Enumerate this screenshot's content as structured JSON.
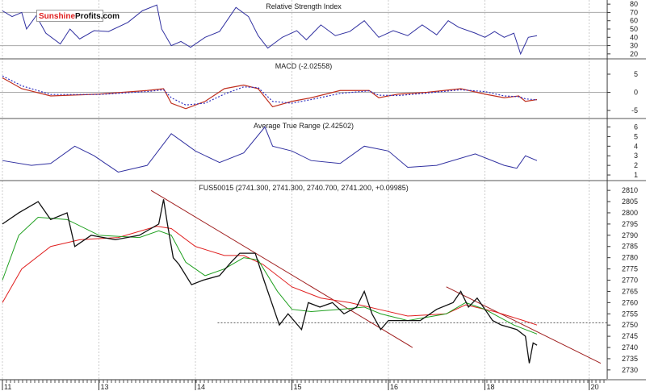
{
  "logo": {
    "part1": "Sunshine",
    "part2": "Profits.com"
  },
  "chart_data": [
    {
      "type": "line",
      "title": "Relative Strength Index",
      "ylim": [
        15,
        85
      ],
      "yticks": [
        20,
        30,
        40,
        50,
        60,
        70,
        80
      ],
      "reference_lines": [
        70,
        30
      ],
      "color": "#3030a0",
      "x": [
        0,
        0.1,
        0.2,
        0.25,
        0.35,
        0.45,
        0.6,
        0.7,
        0.8,
        0.95,
        1.1,
        1.3,
        1.45,
        1.6,
        1.65,
        1.75,
        1.85,
        1.95,
        2.1,
        2.25,
        2.42,
        2.55,
        2.65,
        2.75,
        2.9,
        3.05,
        3.15,
        3.3,
        3.45,
        3.6,
        3.75,
        3.9,
        4.05,
        4.2,
        4.35,
        4.5,
        4.62,
        4.73,
        4.9,
        5.0,
        5.1,
        5.2,
        5.3,
        5.37,
        5.45,
        5.54
      ],
      "values": [
        72,
        65,
        70,
        50,
        66,
        45,
        32,
        50,
        38,
        48,
        47,
        58,
        72,
        79,
        50,
        30,
        35,
        28,
        40,
        47,
        76,
        65,
        42,
        27,
        40,
        48,
        37,
        55,
        42,
        47,
        60,
        40,
        48,
        42,
        55,
        43,
        60,
        52,
        45,
        40,
        47,
        40,
        45,
        20,
        40,
        42
      ]
    },
    {
      "type": "line",
      "title": "MACD (-2.02558)",
      "ylim": [
        -7,
        9
      ],
      "yticks": [
        5,
        0,
        -5
      ],
      "reference_lines": [
        0
      ],
      "x": [
        0,
        0.2,
        0.5,
        1.0,
        1.5,
        1.67,
        1.75,
        1.9,
        2.1,
        2.3,
        2.5,
        2.65,
        2.8,
        3.0,
        3.2,
        3.5,
        3.8,
        3.9,
        4.1,
        4.4,
        4.75,
        5.0,
        5.2,
        5.35,
        5.42,
        5.54
      ],
      "series": [
        {
          "name": "MACD",
          "color": "#c03020",
          "values": [
            4,
            1,
            -1,
            -0.5,
            0.5,
            1,
            -3,
            -4.5,
            -2.5,
            1,
            2,
            1,
            -4,
            -2.5,
            -1.5,
            0.5,
            0.5,
            -1.5,
            -0.5,
            0,
            1,
            -0.5,
            -1.5,
            -1,
            -2.5,
            -2
          ]
        },
        {
          "name": "Signal",
          "color": "#3030c0",
          "dashed": true,
          "values": [
            4.5,
            1.8,
            -0.6,
            -0.6,
            0.2,
            0.7,
            -1.5,
            -3.5,
            -3,
            -0.5,
            1.5,
            1.3,
            -2.5,
            -3,
            -2,
            -0.3,
            0.4,
            -0.8,
            -0.9,
            -0.2,
            0.7,
            0.2,
            -1,
            -1.2,
            -1.8,
            -2.1
          ]
        }
      ]
    },
    {
      "type": "line",
      "title": "Average True Range (2.42502)",
      "ylim": [
        0.5,
        6.8
      ],
      "yticks": [
        1,
        2,
        3,
        4,
        5,
        6
      ],
      "color": "#3030a0",
      "x": [
        0,
        0.3,
        0.5,
        0.75,
        0.95,
        1.2,
        1.5,
        1.75,
        2.0,
        2.25,
        2.5,
        2.72,
        2.8,
        3.0,
        3.2,
        3.5,
        3.75,
        4.0,
        4.2,
        4.5,
        4.9,
        5.2,
        5.33,
        5.42,
        5.54
      ],
      "values": [
        2.5,
        2,
        2.2,
        4,
        3,
        1.3,
        2,
        5.3,
        3.5,
        2.3,
        3.3,
        6,
        4,
        3.5,
        2.5,
        2.2,
        4,
        3.5,
        1.8,
        2,
        3.2,
        2,
        1.7,
        3,
        2.5
      ]
    },
    {
      "type": "line",
      "title": "FUS50015 (2741.300, 2741.300, 2740.700, 2741.200, +0.09985)",
      "ylim": [
        2726,
        2814
      ],
      "yticks": [
        2730,
        2735,
        2740,
        2745,
        2750,
        2755,
        2760,
        2765,
        2770,
        2775,
        2780,
        2785,
        2790,
        2795,
        2800,
        2805,
        2810
      ],
      "xticks": [
        {
          "t": 0,
          "label": "11"
        },
        {
          "t": 1,
          "label": "13"
        },
        {
          "t": 2,
          "label": "14"
        },
        {
          "t": 3,
          "label": "15"
        },
        {
          "t": 4,
          "label": "16"
        },
        {
          "t": 5,
          "label": "18"
        },
        {
          "t": 6.08,
          "label": "20"
        }
      ],
      "price": {
        "color": "#111111",
        "x": [
          0,
          0.17,
          0.37,
          0.5,
          0.67,
          0.75,
          0.92,
          1.17,
          1.42,
          1.62,
          1.67,
          1.71,
          1.77,
          1.83,
          1.96,
          2.08,
          2.25,
          2.37,
          2.46,
          2.62,
          2.71,
          2.79,
          2.87,
          2.96,
          3.1,
          3.17,
          3.29,
          3.42,
          3.54,
          3.67,
          3.75,
          3.83,
          3.92,
          4.0,
          4.17,
          4.33,
          4.5,
          4.67,
          4.75,
          4.83,
          4.92,
          5.0,
          5.08,
          5.17,
          5.33,
          5.42,
          5.46,
          5.5,
          5.54
        ],
        "values": [
          2795,
          2800,
          2805,
          2797,
          2800,
          2785,
          2790,
          2788,
          2790,
          2795,
          2806,
          2795,
          2780,
          2777,
          2768,
          2770,
          2772,
          2778,
          2782,
          2782,
          2770,
          2760,
          2750,
          2755,
          2748,
          2760,
          2758,
          2760,
          2755,
          2758,
          2765,
          2755,
          2748,
          2752,
          2752,
          2752,
          2757,
          2760,
          2765,
          2758,
          2762,
          2757,
          2752,
          2750,
          2748,
          2745,
          2733,
          2742,
          2741
        ]
      },
      "ma_short": {
        "color": "#20a020",
        "x": [
          0,
          0.17,
          0.37,
          0.67,
          1.0,
          1.42,
          1.62,
          1.75,
          1.9,
          2.1,
          2.3,
          2.5,
          2.65,
          2.85,
          3.0,
          3.2,
          3.5,
          3.75,
          3.92,
          4.2,
          4.6,
          4.8,
          5.0,
          5.3,
          5.54
        ],
        "values": [
          2770,
          2790,
          2798,
          2797,
          2790,
          2789,
          2792,
          2790,
          2778,
          2772,
          2775,
          2780,
          2779,
          2765,
          2757,
          2756,
          2757,
          2758,
          2755,
          2752,
          2755,
          2760,
          2757,
          2750,
          2746
        ]
      },
      "ma_long": {
        "color": "#e02020",
        "x": [
          0,
          0.2,
          0.5,
          0.8,
          1.2,
          1.6,
          1.75,
          2.0,
          2.3,
          2.5,
          2.7,
          3.0,
          3.3,
          3.6,
          3.9,
          4.2,
          4.6,
          4.8,
          5.1,
          5.4,
          5.54
        ],
        "values": [
          2760,
          2775,
          2785,
          2788,
          2789,
          2794,
          2793,
          2785,
          2781,
          2781,
          2777,
          2767,
          2762,
          2760,
          2757,
          2754,
          2755,
          2759,
          2756,
          2752,
          2750
        ]
      },
      "trendlines": [
        {
          "color": "#a02020",
          "from": [
            1.54,
            2810
          ],
          "to": [
            4.25,
            2740
          ]
        },
        {
          "color": "#a02020",
          "from": [
            4.6,
            2767
          ],
          "to": [
            6.2,
            2733
          ]
        }
      ],
      "hline": {
        "value": 2751,
        "from": 2.23,
        "dashed": true
      }
    }
  ]
}
